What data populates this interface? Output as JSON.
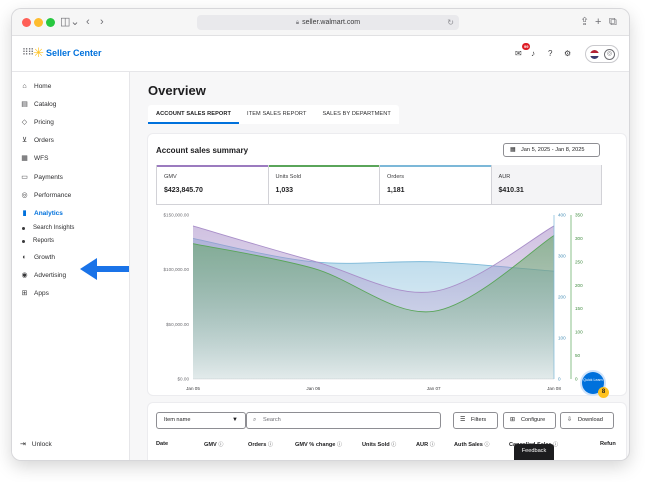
{
  "browser": {
    "url": "seller.walmart.com"
  },
  "header": {
    "brand": "Seller Center",
    "notification_count": "99"
  },
  "sidebar": {
    "items": [
      {
        "label": "Home",
        "icon": "home-icon",
        "glyph": "⌂"
      },
      {
        "label": "Catalog",
        "icon": "catalog-icon",
        "glyph": "▤"
      },
      {
        "label": "Pricing",
        "icon": "pricing-icon",
        "glyph": "◇"
      },
      {
        "label": "Orders",
        "icon": "cart-icon",
        "glyph": "⊻"
      },
      {
        "label": "WFS",
        "icon": "wfs-icon",
        "glyph": "▦"
      },
      {
        "label": "Payments",
        "icon": "payments-icon",
        "glyph": "▭"
      },
      {
        "label": "Performance",
        "icon": "performance-icon",
        "glyph": "◎"
      },
      {
        "label": "Analytics",
        "icon": "analytics-icon",
        "glyph": "▮"
      }
    ],
    "sub_items": [
      {
        "label": "Search Insights"
      },
      {
        "label": "Reports"
      }
    ],
    "bottom_items": [
      {
        "label": "Growth",
        "icon": "growth-icon",
        "glyph": "◐"
      },
      {
        "label": "Advertising",
        "icon": "advertising-icon",
        "glyph": "◉"
      },
      {
        "label": "Apps",
        "icon": "apps-icon",
        "glyph": "⊞"
      }
    ],
    "unlock": "Unlock"
  },
  "main": {
    "title": "Overview",
    "tabs": [
      {
        "label": "ACCOUNT SALES REPORT"
      },
      {
        "label": "ITEM SALES REPORT"
      },
      {
        "label": "SALES BY DEPARTMENT"
      }
    ],
    "summary_title": "Account sales summary",
    "date_range": "Jan 5, 2025 - Jan 8, 2025",
    "metrics": [
      {
        "label": "GMV",
        "value": "$423,845.70",
        "color": "#9b7bbf"
      },
      {
        "label": "Units Sold",
        "value": "1,033",
        "color": "#5aa55a"
      },
      {
        "label": "Orders",
        "value": "1,181",
        "color": "#7cb8d8"
      },
      {
        "label": "AUR",
        "value": "$410.31",
        "color": "#f4f4f6"
      }
    ]
  },
  "chart_data": {
    "type": "area",
    "categories": [
      "Jan 05",
      "Jan 06",
      "Jan 07",
      "Jan 08"
    ],
    "y_left_ticks": [
      "$150,000.00",
      "$100,000.00",
      "$50,000.00",
      "$0.00"
    ],
    "y_left_range": [
      0,
      150000
    ],
    "y_mid_ticks": [
      "400",
      "300",
      "200",
      "100",
      "0"
    ],
    "y_mid_range": [
      0,
      400
    ],
    "y_right_ticks": [
      "350",
      "300",
      "250",
      "200",
      "150",
      "100",
      "50",
      "0"
    ],
    "y_right_range": [
      0,
      350
    ],
    "series": [
      {
        "values": [
          140000,
          108000,
          80000,
          140000
        ],
        "color": "#a98fc9"
      },
      {
        "values": [
          330,
          270,
          165,
          350
        ],
        "color": "#5aa55a"
      },
      {
        "values": [
          300,
          250,
          250,
          230
        ],
        "color": "#7cb8d8"
      }
    ]
  },
  "table": {
    "select_label": "Item name",
    "search_placeholder": "Search",
    "filters_label": "Filters",
    "configure_label": "Configure",
    "download_label": "Download",
    "columns": [
      {
        "label": "Date",
        "info": ""
      },
      {
        "label": "GMV",
        "info": "ⓘ"
      },
      {
        "label": "Orders",
        "info": "ⓘ"
      },
      {
        "label": "GMV % change",
        "info": "ⓘ"
      },
      {
        "label": "Units Sold",
        "info": "ⓘ"
      },
      {
        "label": "AUR",
        "info": "ⓘ"
      },
      {
        "label": "Auth Sales",
        "info": "ⓘ"
      },
      {
        "label": "Cancelled Sales",
        "info": "ⓘ"
      },
      {
        "label": "Refun",
        "info": ""
      }
    ]
  },
  "quick_learn": {
    "label": "Quick Learn",
    "badge": "8"
  },
  "feedback": "Feedback"
}
